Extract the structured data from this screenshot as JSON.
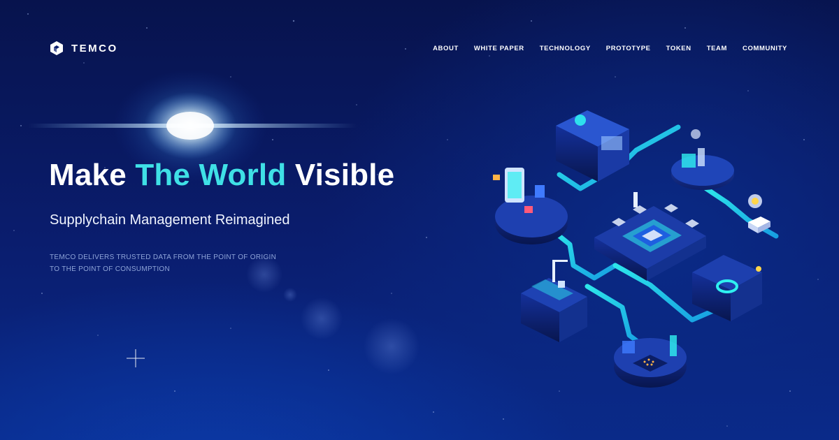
{
  "brand": {
    "name": "TEMCO"
  },
  "nav": [
    {
      "label": "ABOUT"
    },
    {
      "label": "WHITE PAPER"
    },
    {
      "label": "TECHNOLOGY"
    },
    {
      "label": "PROTOTYPE"
    },
    {
      "label": "TOKEN"
    },
    {
      "label": "TEAM"
    },
    {
      "label": "COMMUNITY"
    }
  ],
  "hero": {
    "title_part1": "Make",
    "title_accent": "The World",
    "title_part2": "Visible",
    "subtitle": "Supplychain Management Reimagined",
    "desc_line1": "TEMCO DELIVERS TRUSTED DATA FROM THE POINT OF ORIGIN",
    "desc_line2": "TO THE POINT OF CONSUMPTION"
  },
  "colors": {
    "accent": "#3fe0e6",
    "background_top": "#07134d",
    "background_bottom": "#0a2a8a",
    "desc_text": "#8ea4d8"
  },
  "illustration": {
    "icons": [
      "supply-chain-isometric-illustration",
      "factory-icon",
      "ship-icon",
      "truck-icon",
      "qr-chip-icon",
      "lightbulb-icon"
    ]
  }
}
